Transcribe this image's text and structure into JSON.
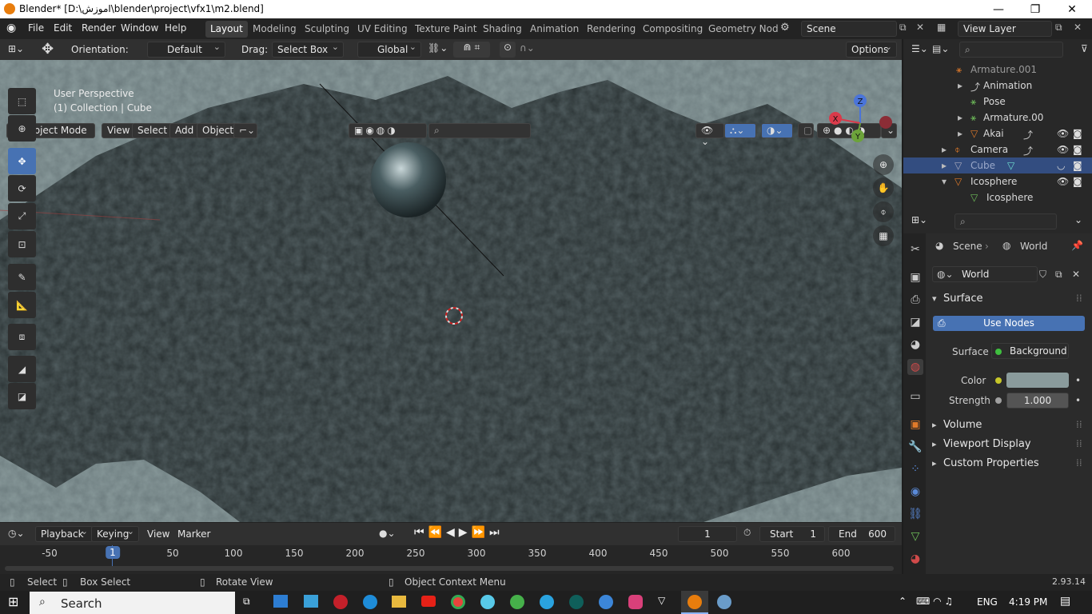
{
  "window": {
    "title": "Blender* [D:\\اموزش\\blender\\project\\vfx1\\m2.blend]",
    "minimize": "—",
    "maximize": "❐",
    "close": "✕"
  },
  "menubar": {
    "items": [
      "File",
      "Edit",
      "Render",
      "Window",
      "Help"
    ],
    "workspaces": [
      "Layout",
      "Modeling",
      "Sculpting",
      "UV Editing",
      "Texture Paint",
      "Shading",
      "Animation",
      "Rendering",
      "Compositing",
      "Geometry Nod"
    ],
    "active_workspace": "Layout",
    "scene": "Scene",
    "view_layer": "View Layer"
  },
  "toolheader": {
    "orientation_label": "Orientation:",
    "orientation_value": "Default",
    "drag_label": "Drag:",
    "drag_value": "Select Box",
    "transform": "Global",
    "options": "Options"
  },
  "viewport": {
    "mode": "Object Mode",
    "menus": [
      "View",
      "Select",
      "Add",
      "Object"
    ],
    "info_line1": "User Perspective",
    "info_line2": "(1) Collection | Cube",
    "gizmo": {
      "x": "X",
      "y": "Y",
      "z": "Z"
    },
    "colors": {
      "ground": "#2c3435",
      "sky": "#8a9b9c"
    }
  },
  "timeline": {
    "menus": [
      "Playback",
      "Keying",
      "View",
      "Marker"
    ],
    "current_frame": "1",
    "start_label": "Start",
    "start": "1",
    "end_label": "End",
    "end": "600",
    "ticks": [
      "-50",
      "1",
      "50",
      "100",
      "150",
      "200",
      "250",
      "300",
      "350",
      "400",
      "450",
      "500",
      "550",
      "600"
    ]
  },
  "statusbar": {
    "select": "Select",
    "box_select": "Box Select",
    "rotate_view": "Rotate View",
    "context_menu": "Object Context Menu",
    "version": "2.93.14"
  },
  "taskbar": {
    "search": "Search",
    "lang": "ENG",
    "time": "4:19 PM"
  },
  "outliner": {
    "rows": [
      {
        "label": "Armature.001",
        "dim": true
      },
      {
        "label": "Animation"
      },
      {
        "label": "Pose"
      },
      {
        "label": "Armature.00"
      },
      {
        "label": "Akai"
      },
      {
        "label": "Camera"
      },
      {
        "label": "Cube",
        "selected": true
      },
      {
        "label": "Icosphere"
      },
      {
        "label": "Icosphere"
      }
    ]
  },
  "properties": {
    "breadcrumb_scene": "Scene",
    "breadcrumb_world": "World",
    "world_name": "World",
    "surface_panel": "Surface",
    "use_nodes": "Use Nodes",
    "surface_label": "Surface",
    "surface_value": "Background",
    "color_label": "Color",
    "color_value": "#8a9b9c",
    "strength_label": "Strength",
    "strength_value": "1.000",
    "volume": "Volume",
    "viewport_display": "Viewport Display",
    "custom_properties": "Custom Properties"
  }
}
